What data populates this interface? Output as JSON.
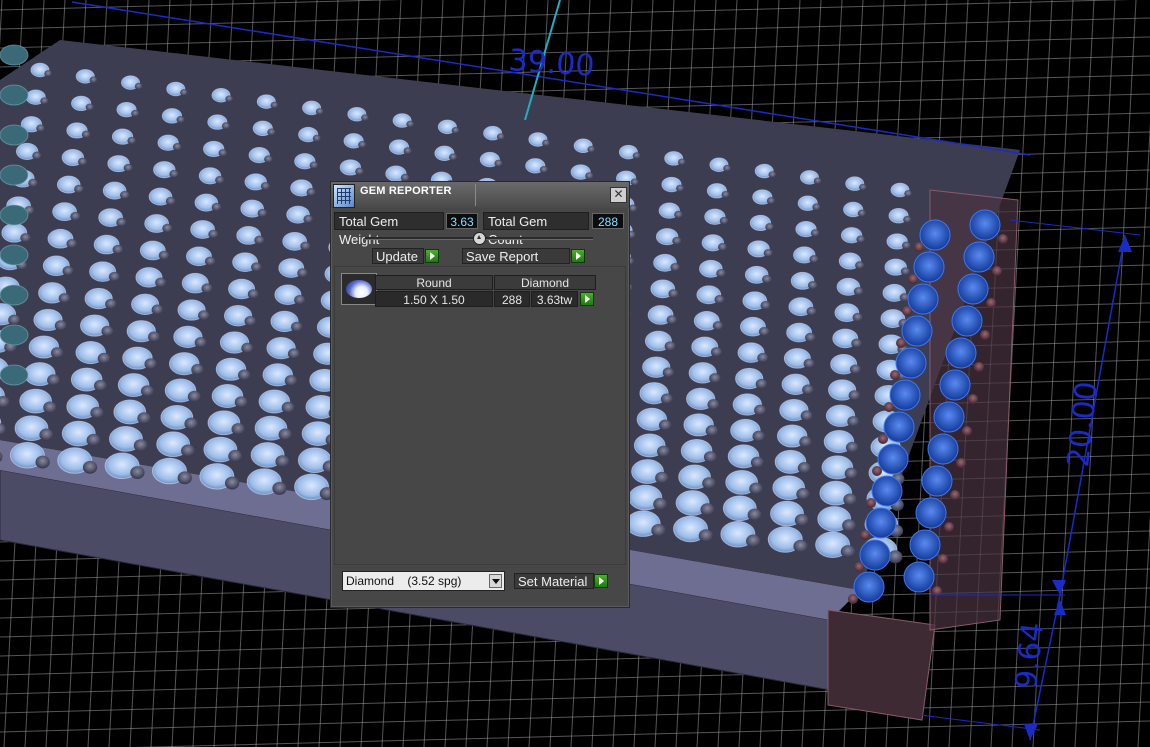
{
  "viewport": {
    "dimensions": {
      "width_label": "39.00",
      "height_label": "20.00",
      "depth_label": "9.64"
    },
    "colors": {
      "background": "#000000",
      "grid": "#9a9a9a",
      "dimension": "#1a2bc8",
      "gem_light": "#a9c8f2",
      "gem_dark": "#56566e",
      "gem_blue": "#1f56c4",
      "gem_red": "#7a4a55"
    }
  },
  "gem_reporter": {
    "title": "GEM REPORTER",
    "close_icon": "close-icon",
    "total_weight": {
      "label": "Total Gem Weight",
      "value": "3.63"
    },
    "total_count": {
      "label": "Total Gem Count",
      "value": "288"
    },
    "update_label": "Update",
    "save_report_label": "Save Report",
    "table": {
      "headers": [
        "Round",
        "Diamond"
      ],
      "rows": [
        {
          "size": "1.50 X 1.50",
          "count": "288",
          "weight": "3.63tw"
        }
      ]
    },
    "material": {
      "selected": "Diamond    (3.52 spg)"
    },
    "set_material_label": "Set Material"
  }
}
